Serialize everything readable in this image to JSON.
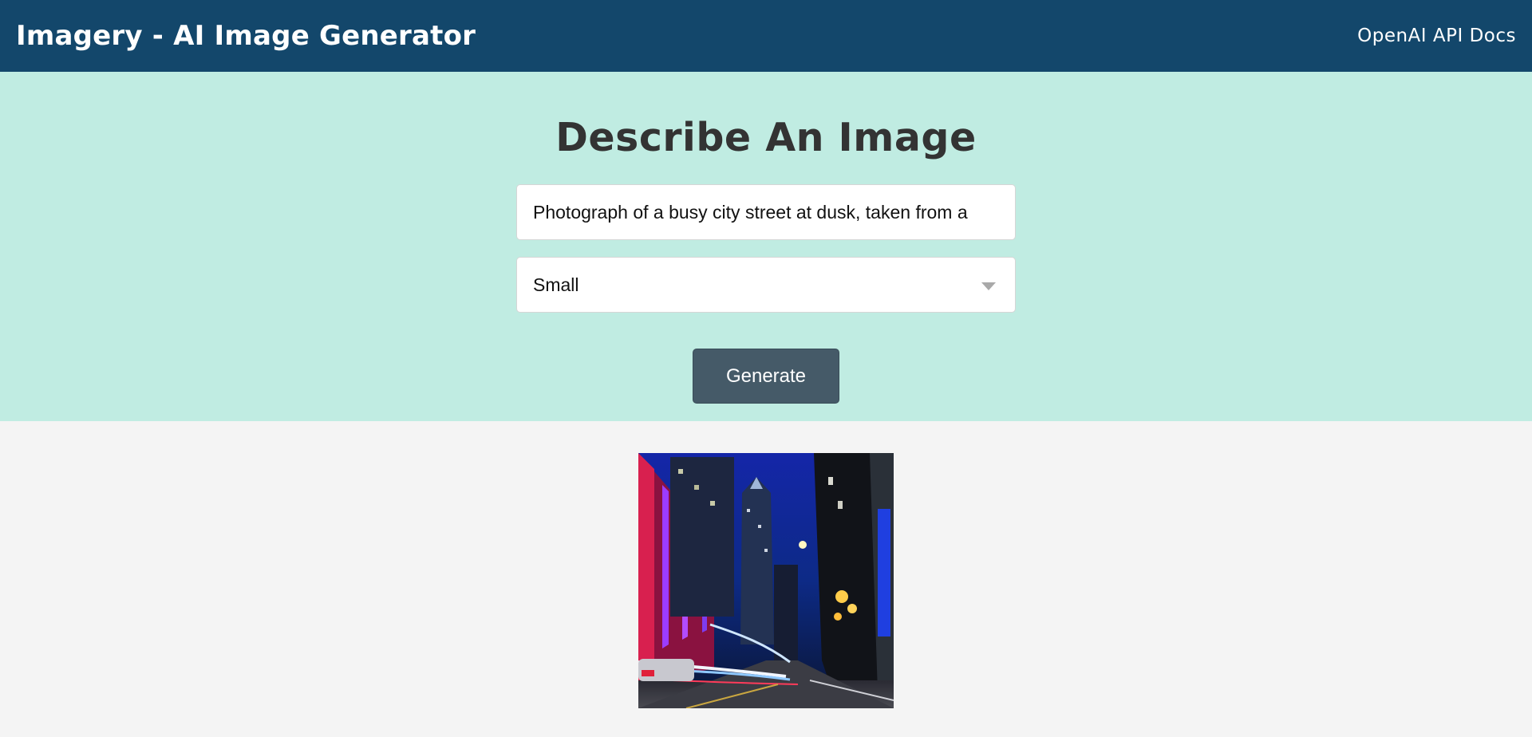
{
  "header": {
    "brand": "Imagery - AI Image Generator",
    "docs_link": "OpenAI API Docs"
  },
  "showcase": {
    "title": "Describe An Image",
    "prompt_value": "Photograph of a busy city street at dusk, taken from a",
    "size_select": {
      "selected": "Small"
    },
    "generate_label": "Generate"
  },
  "result": {
    "image_icon": "city-street-night-photo"
  },
  "colors": {
    "navbar": "#13476b",
    "showcase_bg": "#c0ece2",
    "button": "#455a68",
    "page_bg": "#f4f4f4"
  }
}
